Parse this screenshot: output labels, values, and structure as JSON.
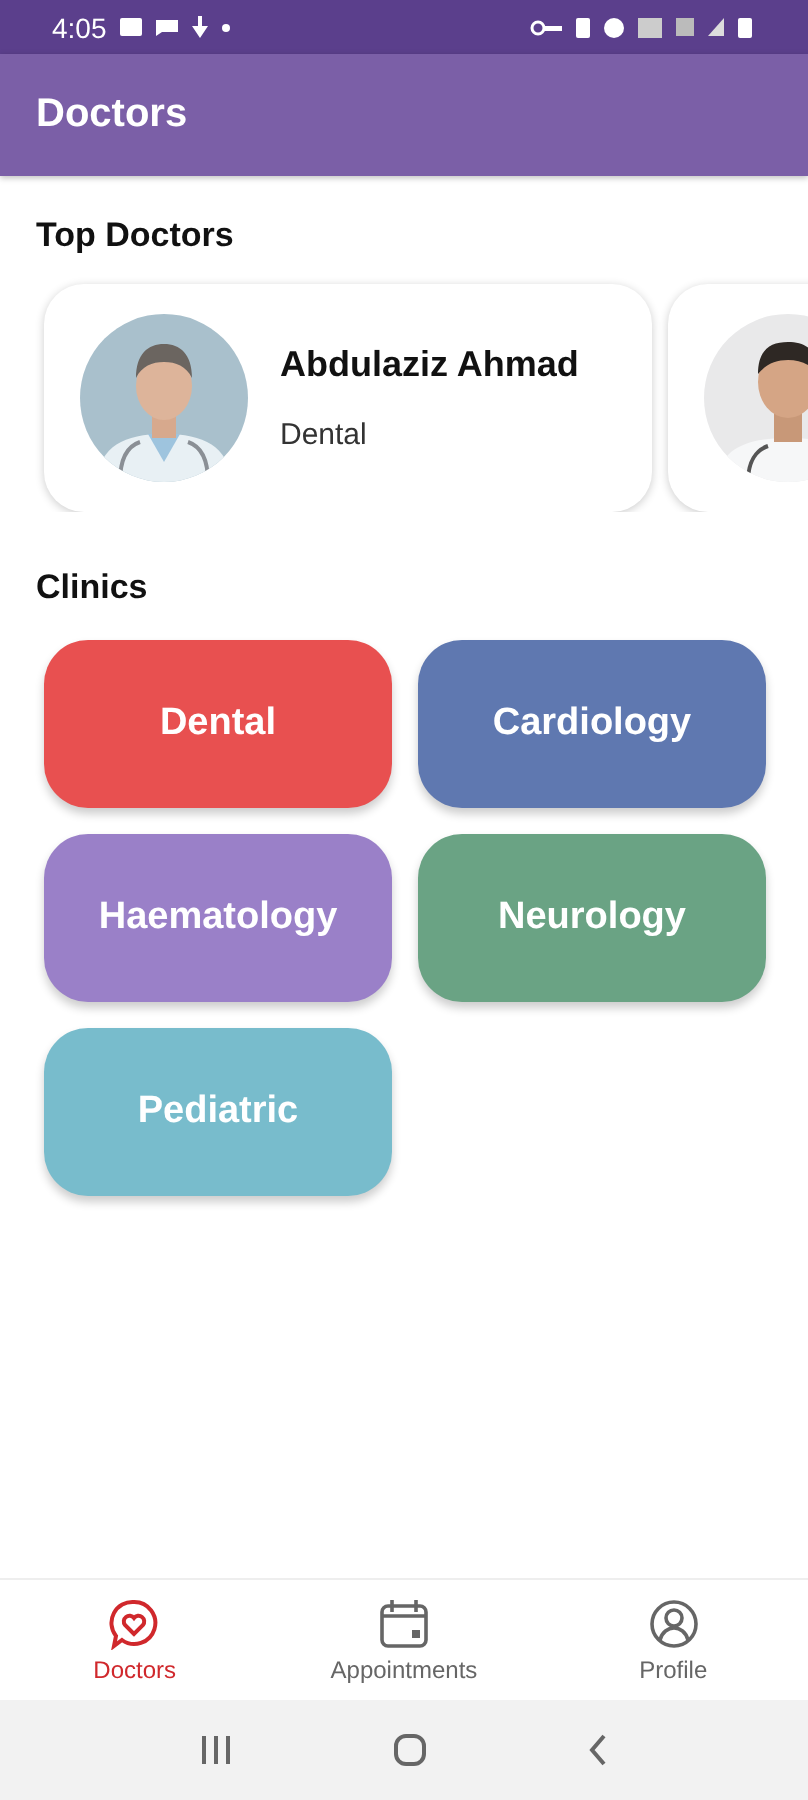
{
  "status_bar": {
    "time": "4:05"
  },
  "app_bar": {
    "title": "Doctors"
  },
  "top_doctors": {
    "title": "Top Doctors",
    "items": [
      {
        "kind": "card",
        "name": "Abdulaziz Ahmad",
        "specialty": "Dental"
      },
      {
        "kind": "picture"
      }
    ]
  },
  "clinics": {
    "title": "Clinics",
    "items": [
      {
        "label": "Dental",
        "color": "#e85050"
      },
      {
        "label": "Cardiology",
        "color": "#5f78b0"
      },
      {
        "label": "Haematology",
        "color": "#9a80c8"
      },
      {
        "label": "Neurology",
        "color": "#6aa384"
      },
      {
        "label": "Pediatric",
        "color": "#78bccc"
      }
    ]
  },
  "bottom_nav": [
    {
      "label": "Doctors",
      "kind": "heart",
      "selected": true
    },
    {
      "label": "Appointments",
      "kind": "calendar",
      "selected": false
    },
    {
      "label": "Profile",
      "kind": "person",
      "selected": false
    }
  ]
}
